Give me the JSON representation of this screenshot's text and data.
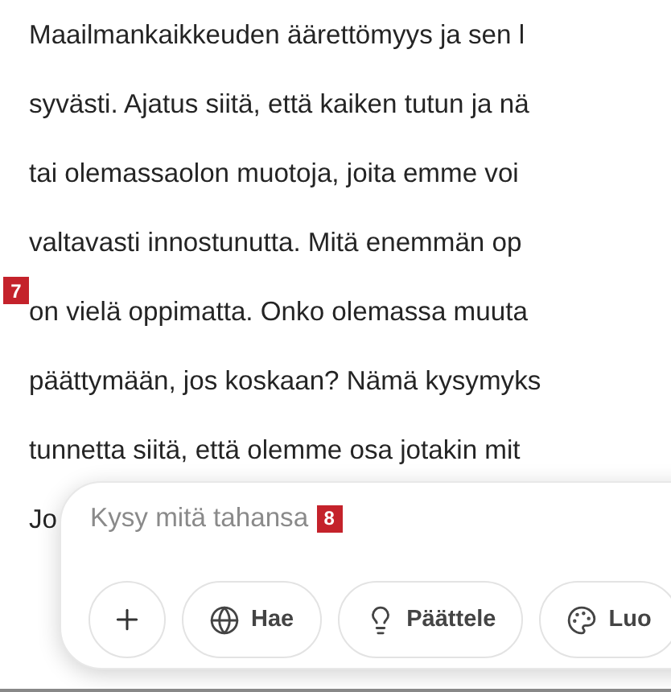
{
  "article": {
    "lines": [
      "Maailmankaikkeuden äärettömyys ja sen l",
      "syvästi. Ajatus siitä, että kaiken tutun ja nä",
      "tai olemassaolon muotoja, joita emme voi",
      "valtavasti innostunutta. Mitä enemmän op",
      "on vielä oppimatta. Onko olemassa muuta",
      "päättymään, jos koskaan? Nämä kysymyks",
      "tunnetta siitä, että olemme osa jotakin mit",
      "Jo"
    ],
    "marker": "7"
  },
  "composer": {
    "placeholder": "Kysy mitä tahansa",
    "marker": "8",
    "buttons": [
      {
        "kind": "add"
      },
      {
        "kind": "tool",
        "label": "Hae"
      },
      {
        "kind": "tool",
        "label": "Päättele"
      },
      {
        "kind": "tool",
        "label": "Luo"
      }
    ]
  }
}
